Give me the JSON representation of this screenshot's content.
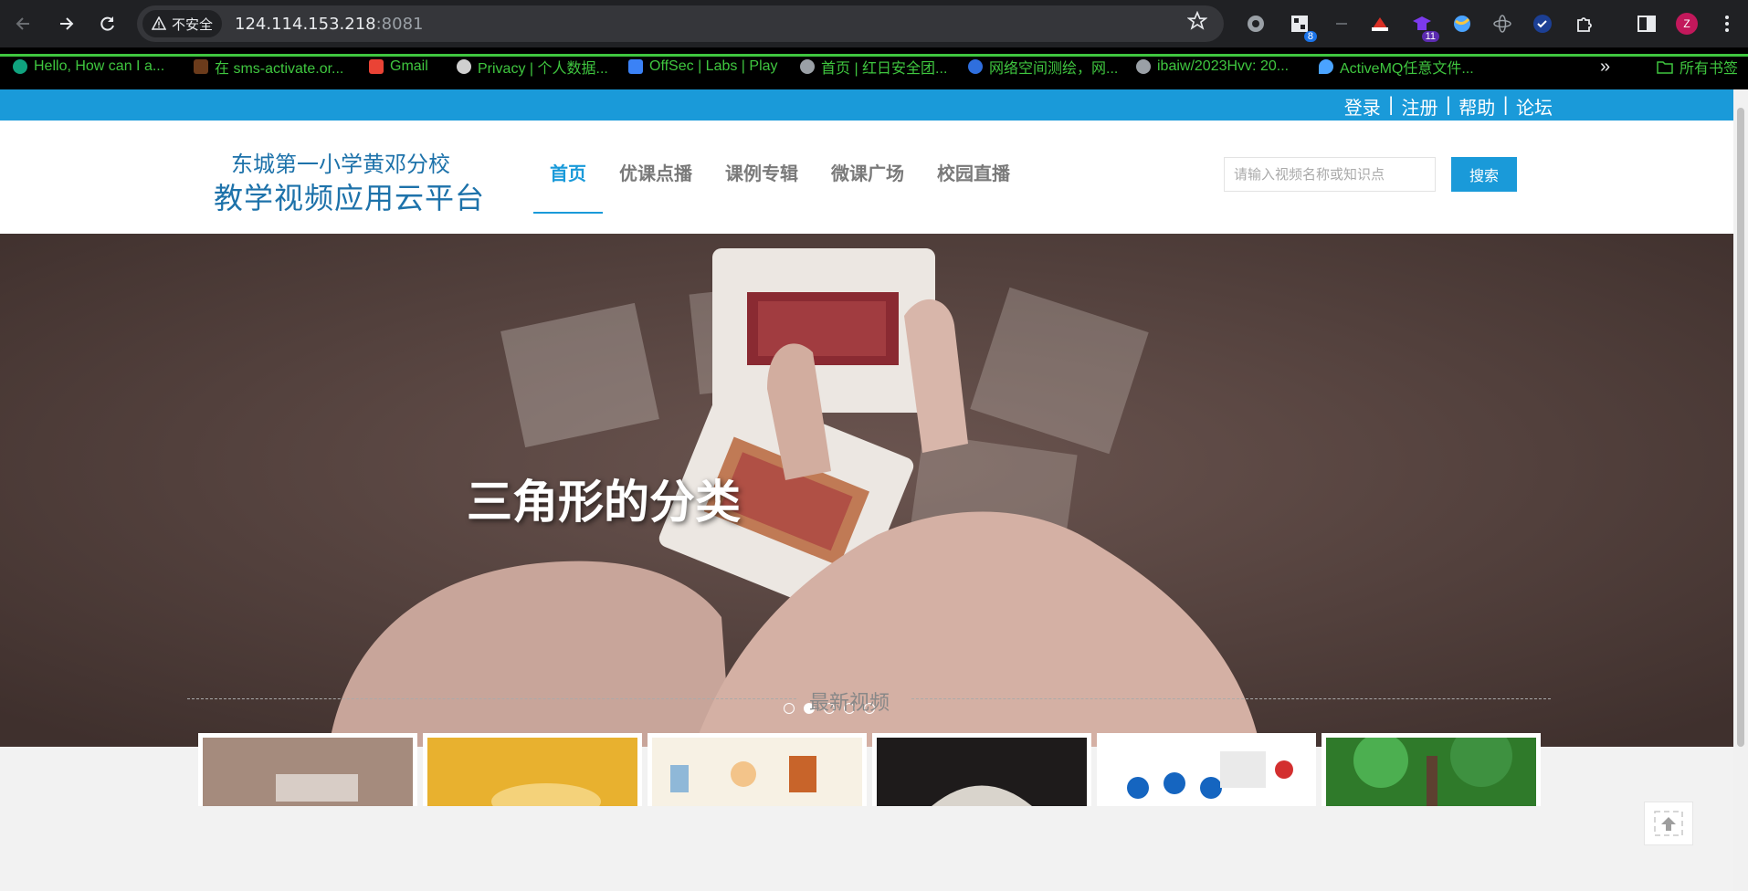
{
  "browser": {
    "insecure_label": "不安全",
    "url_host": "124.114.153.218",
    "url_port": ":8081",
    "extensions": [
      {
        "name": "record-icon",
        "badge": ""
      },
      {
        "name": "qr-icon",
        "badge": "8"
      },
      {
        "name": "dash-icon",
        "badge": ""
      },
      {
        "name": "hat-icon",
        "badge": ""
      },
      {
        "name": "grad-icon",
        "badge": "11"
      },
      {
        "name": "globe-icon",
        "badge": ""
      },
      {
        "name": "atom-icon",
        "badge": ""
      },
      {
        "name": "check-icon",
        "badge": ""
      },
      {
        "name": "puzzle-icon",
        "badge": ""
      }
    ],
    "profile_initial": "Z"
  },
  "bookmarks": {
    "items": [
      {
        "label": "Hello, How can I a...",
        "icon": "chatgpt-icon",
        "color": "#10a37f"
      },
      {
        "label": "在 sms-activate.or...",
        "icon": "sms-icon",
        "color": "#6b3b1b"
      },
      {
        "label": "Gmail",
        "icon": "gmail-icon",
        "color": "#ea4335"
      },
      {
        "label": "Privacy | 个人数据...",
        "icon": "privacy-icon",
        "color": "#cfcfcf"
      },
      {
        "label": "OffSec | Labs | Play",
        "icon": "offsec-icon",
        "color": "#3b82f6"
      },
      {
        "label": "首页 | 红日安全团...",
        "icon": "globe-icon",
        "color": "#9aa0a6"
      },
      {
        "label": "网络空间测绘，网...",
        "icon": "fofa-icon",
        "color": "#2f6fde"
      },
      {
        "label": "ibaiw/2023Hvv: 20...",
        "icon": "github-icon",
        "color": "#9aa0a6"
      },
      {
        "label": "ActiveMQ任意文件...",
        "icon": "drop-icon",
        "color": "#4aa3ff"
      }
    ],
    "all_bookmarks": "所有书签"
  },
  "site": {
    "top_links": [
      "登录",
      "注册",
      "帮助",
      "论坛"
    ],
    "logo_line1": "东城第一小学黄邓分校",
    "logo_line2": "教学视频应用云平台",
    "nav": [
      "首页",
      "优课点播",
      "课例专辑",
      "微课广场",
      "校园直播"
    ],
    "active_nav": 0,
    "search_placeholder": "请输入视频名称或知识点",
    "search_button": "搜索",
    "accent": "#1a9ad9"
  },
  "banner": {
    "caption": "三角形的分类",
    "slide_count": 5,
    "active_slide": 1
  },
  "latest": {
    "title": "最新视频",
    "thumbnails": [
      "phone-thumb",
      "hand-thumb",
      "cartoon-thumb",
      "book-thumb",
      "meeting-thumb",
      "forest-thumb"
    ]
  }
}
